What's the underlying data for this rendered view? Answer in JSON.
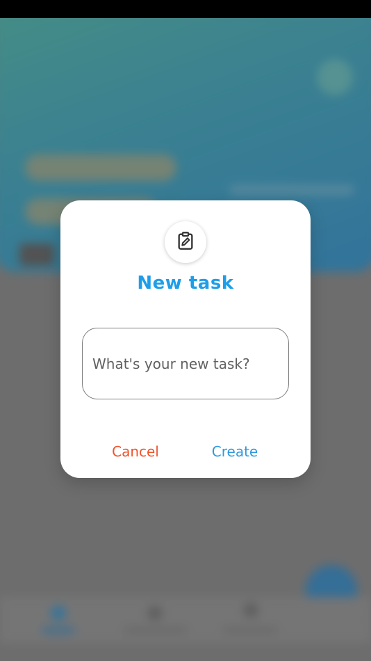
{
  "dialog": {
    "title": "New task",
    "input_placeholder": "What's your new task?",
    "input_value": "",
    "cancel_label": "Cancel",
    "create_label": "Create",
    "icon": "clipboard-edit-icon"
  },
  "colors": {
    "title": "#1e9ee8",
    "cancel": "#f0532b",
    "create": "#2c9ae0",
    "hero_gradient_start": "#2f9e94",
    "hero_gradient_end": "#1377b4"
  }
}
